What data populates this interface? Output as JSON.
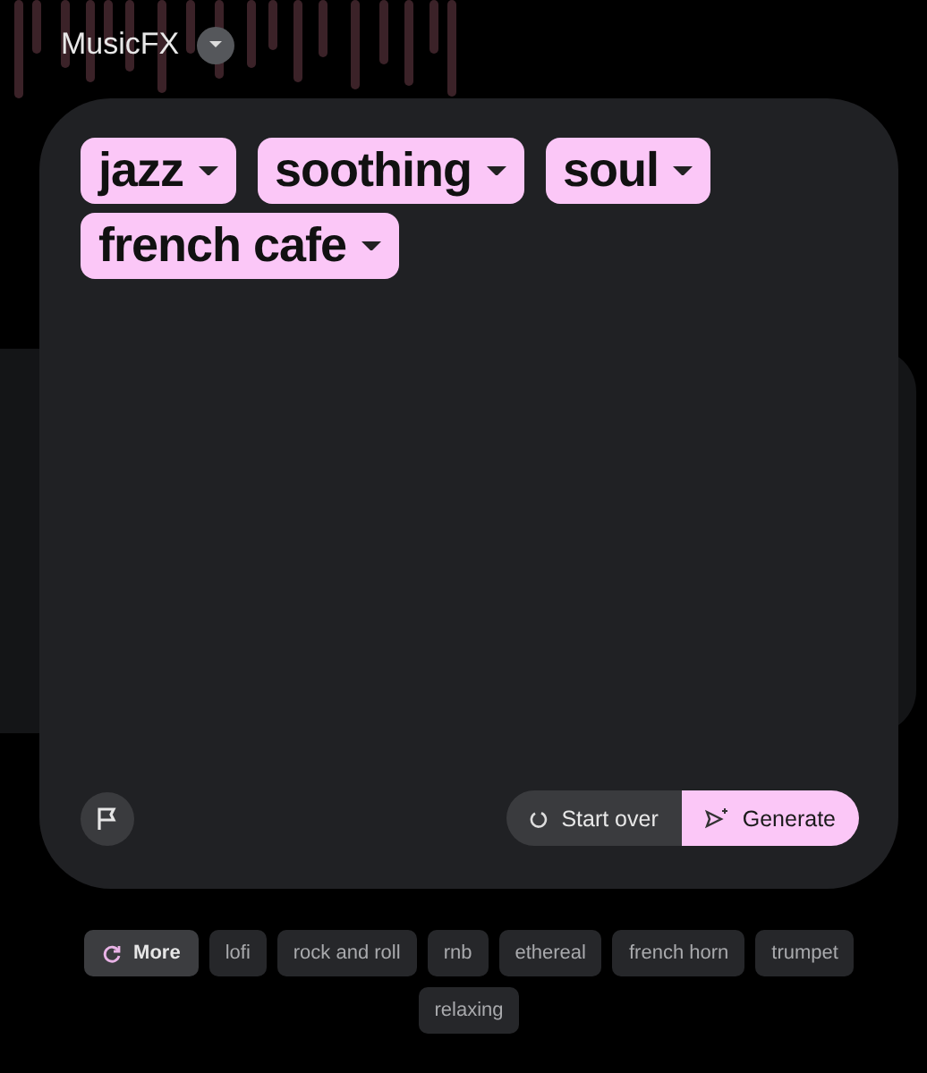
{
  "app": {
    "title": "MusicFX"
  },
  "prompt_chips": [
    {
      "label": "jazz"
    },
    {
      "label": "soothing"
    },
    {
      "label": "soul"
    },
    {
      "label": "french cafe"
    }
  ],
  "actions": [
    {
      "kind": "secondary",
      "label": "Start over"
    },
    {
      "kind": "primary",
      "label": "Generate"
    }
  ],
  "more_button": {
    "label": "More"
  },
  "suggestions": [
    {
      "label": "lofi"
    },
    {
      "label": "rock and roll"
    },
    {
      "label": "rnb"
    },
    {
      "label": "ethereal"
    },
    {
      "label": "french horn"
    },
    {
      "label": "trumpet"
    },
    {
      "label": "relaxing"
    }
  ]
}
